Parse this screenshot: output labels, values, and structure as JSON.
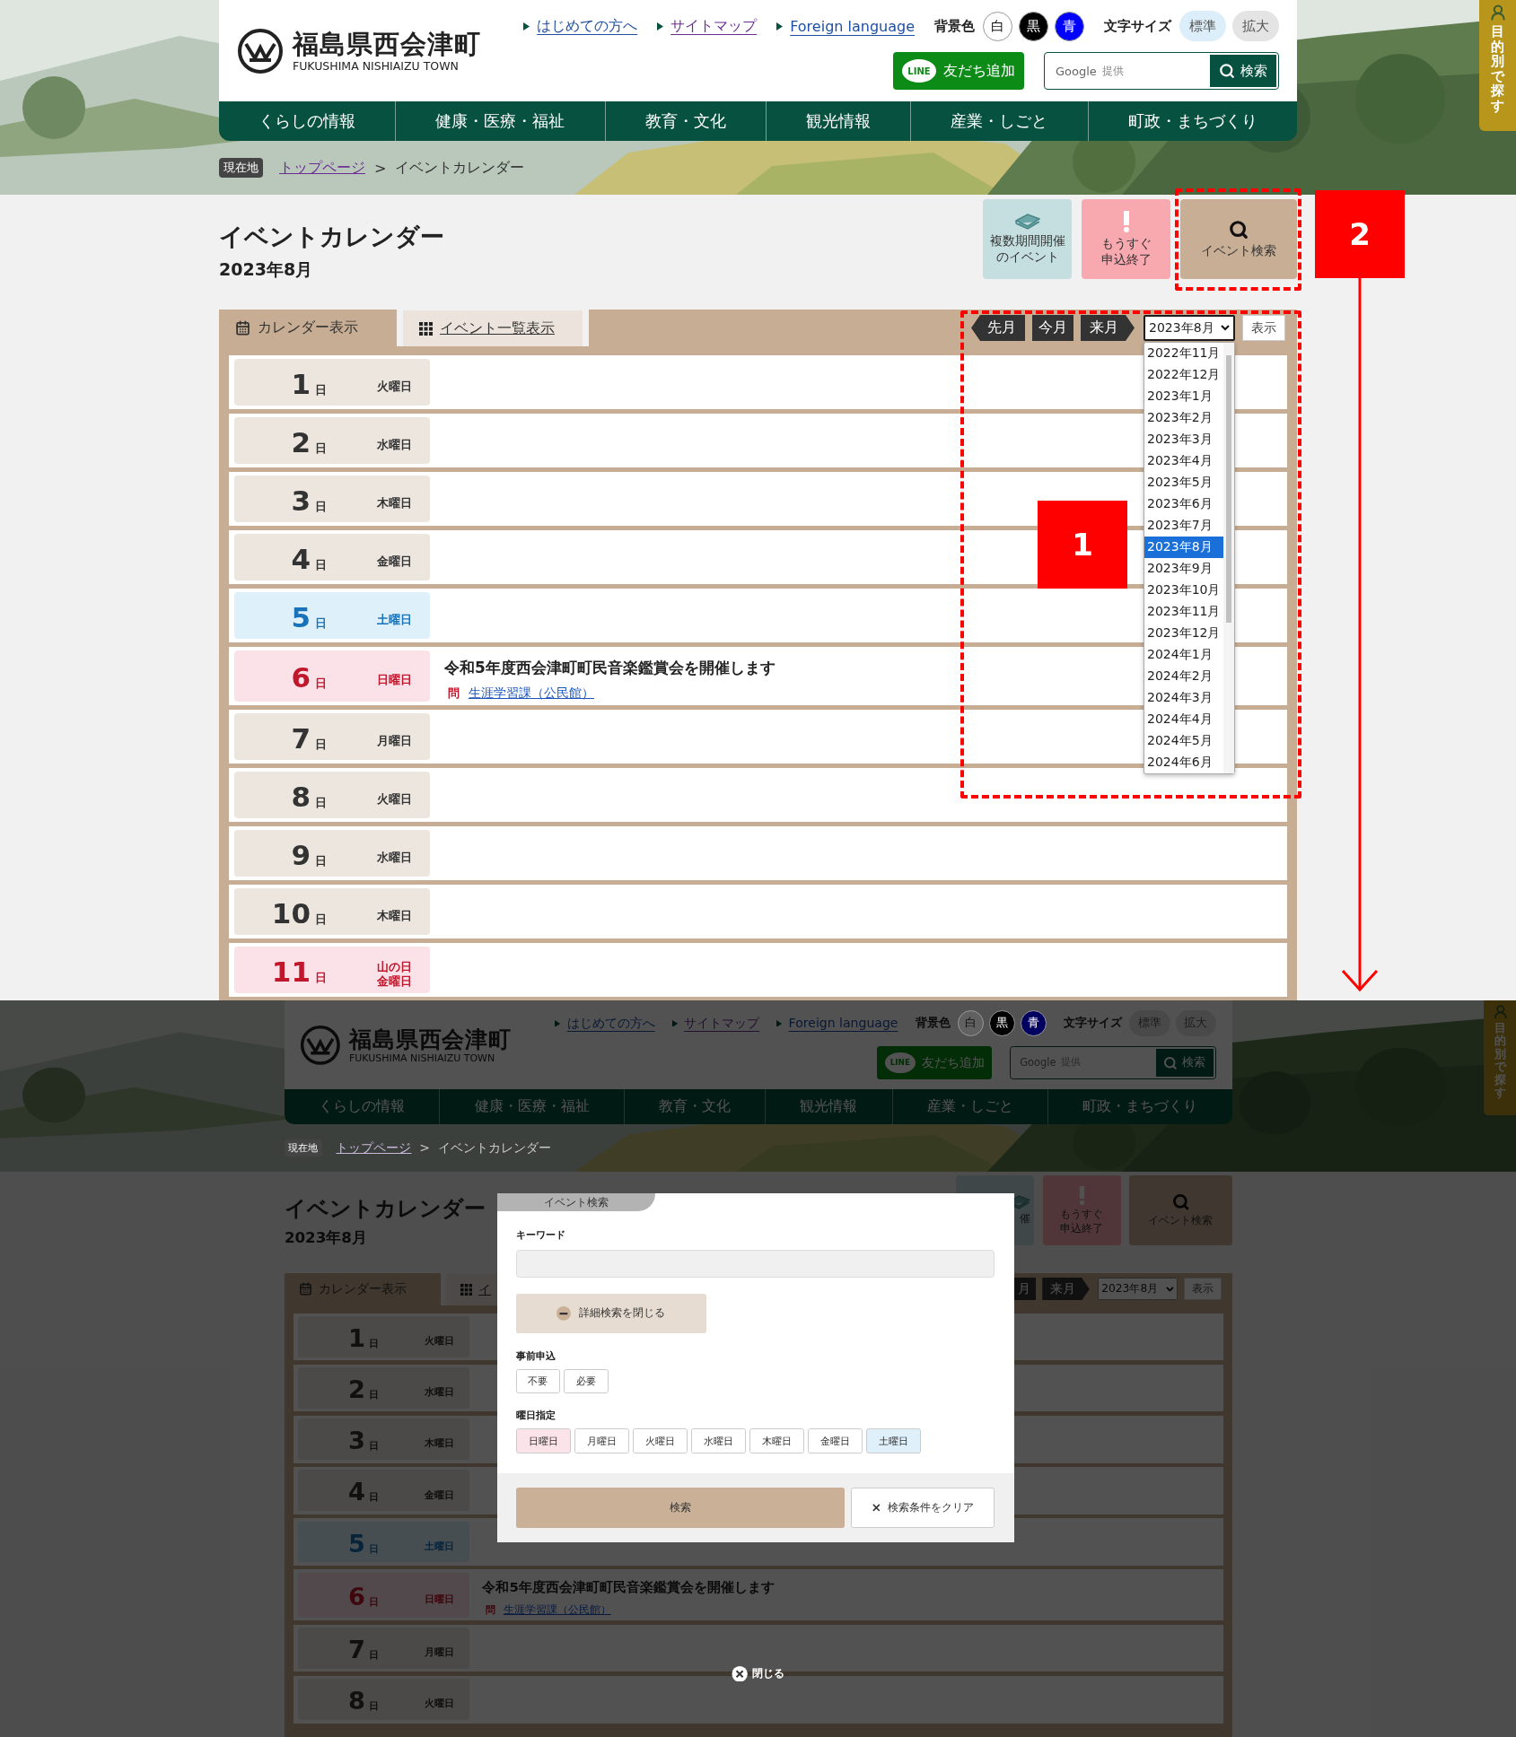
{
  "screens": [
    {
      "header": {
        "logo_title": "福島県西会津町",
        "logo_subtitle": "FUKUSHIMA NISHIAIZU TOWN",
        "links": [
          {
            "label": "はじめての方へ",
            "visited": false
          },
          {
            "label": "サイトマップ",
            "visited": true
          },
          {
            "label": "Foreign language",
            "visited": false
          }
        ],
        "bg_color_label": "背景色",
        "bg_colors": [
          {
            "label": "白",
            "color": "#ffffff"
          },
          {
            "label": "黒",
            "color": "#000000"
          },
          {
            "label": "青",
            "color": "#0000ff"
          }
        ],
        "font_size_label": "文字サイズ",
        "font_sizes": [
          {
            "label": "標準",
            "selected": true
          },
          {
            "label": "拡大",
            "selected": false
          }
        ],
        "line_button": {
          "badge": "LINE",
          "label": "友だち追加"
        },
        "search": {
          "brand": "Google",
          "brand_note": "提供",
          "button": "検索"
        }
      },
      "nav": [
        "くらしの情報",
        "健康・医療・福祉",
        "教育・文化",
        "観光情報",
        "産業・しごと",
        "町政・まちづくり"
      ],
      "side_tab": "目的別で探す",
      "breadcrumb": {
        "badge": "現在地",
        "link": "トップページ",
        "separator": ">",
        "current": "イベントカレンダー"
      },
      "page_title": "イベントカレンダー",
      "page_subtitle": "2023年8月",
      "feature_buttons": [
        {
          "kind": "multi",
          "lines": [
            "複数期間開催",
            "のイベント"
          ],
          "cut": false
        },
        {
          "kind": "deadline",
          "lines": [
            "もうすぐ",
            "申込終了"
          ],
          "cut": false
        },
        {
          "kind": "search",
          "lines": [
            "イベント検索"
          ],
          "cut": false
        }
      ],
      "tabs": [
        {
          "label": "カレンダー表示",
          "selected": true
        },
        {
          "label": "イベント一覧表示",
          "selected": false
        }
      ],
      "month_nav": [
        {
          "label": "先月",
          "kind": "prev"
        },
        {
          "label": "今月",
          "kind": "plain"
        },
        {
          "label": "来月",
          "kind": "next"
        }
      ],
      "month_select": {
        "value": "2023年8月",
        "expanded": true,
        "options": [
          {
            "label": "2022年11月",
            "selected": false
          },
          {
            "label": "2022年12月",
            "selected": false
          },
          {
            "label": "2023年1月",
            "selected": false
          },
          {
            "label": "2023年2月",
            "selected": false
          },
          {
            "label": "2023年3月",
            "selected": false
          },
          {
            "label": "2023年4月",
            "selected": false
          },
          {
            "label": "2023年5月",
            "selected": false
          },
          {
            "label": "2023年6月",
            "selected": false
          },
          {
            "label": "2023年7月",
            "selected": false
          },
          {
            "label": "2023年8月",
            "selected": true
          },
          {
            "label": "2023年9月",
            "selected": false
          },
          {
            "label": "2023年10月",
            "selected": false
          },
          {
            "label": "2023年11月",
            "selected": false
          },
          {
            "label": "2023年12月",
            "selected": false
          },
          {
            "label": "2024年1月",
            "selected": false
          },
          {
            "label": "2024年2月",
            "selected": false
          },
          {
            "label": "2024年3月",
            "selected": false
          },
          {
            "label": "2024年4月",
            "selected": false
          },
          {
            "label": "2024年5月",
            "selected": false
          },
          {
            "label": "2024年6月",
            "selected": false
          }
        ]
      },
      "show_button": "表示",
      "days": [
        {
          "day": "1",
          "unit": "日",
          "weekday": "火曜日",
          "kind": "weekday"
        },
        {
          "day": "2",
          "unit": "日",
          "weekday": "水曜日",
          "kind": "weekday"
        },
        {
          "day": "3",
          "unit": "日",
          "weekday": "木曜日",
          "kind": "weekday"
        },
        {
          "day": "4",
          "unit": "日",
          "weekday": "金曜日",
          "kind": "weekday"
        },
        {
          "day": "5",
          "unit": "日",
          "weekday": "土曜日",
          "kind": "saturday"
        },
        {
          "day": "6",
          "unit": "日",
          "weekday": "日曜日",
          "kind": "holiday",
          "events": [
            {
              "title": "令和5年度西会津町町民音楽鑑賞会を開催します",
              "contact_mark": "問",
              "contact": "生涯学習課（公民館）"
            }
          ]
        },
        {
          "day": "7",
          "unit": "日",
          "weekday": "月曜日",
          "kind": "weekday"
        },
        {
          "day": "8",
          "unit": "日",
          "weekday": "火曜日",
          "kind": "weekday"
        },
        {
          "day": "9",
          "unit": "日",
          "weekday": "水曜日",
          "kind": "weekday"
        },
        {
          "day": "10",
          "unit": "日",
          "weekday": "木曜日",
          "kind": "weekday"
        },
        {
          "day": "11",
          "unit": "日",
          "holiday_name": "山の日",
          "weekday": "金曜日",
          "kind": "holiday"
        }
      ],
      "annotations": [
        {
          "label": "1"
        },
        {
          "label": "2"
        }
      ]
    },
    {
      "header": {
        "logo_title": "福島県西会津町",
        "logo_subtitle": "FUKUSHIMA NISHIAIZU TOWN",
        "links": [
          {
            "label": "はじめての方へ",
            "visited": false
          },
          {
            "label": "サイトマップ",
            "visited": true
          },
          {
            "label": "Foreign language",
            "visited": false
          }
        ],
        "bg_color_label": "背景色",
        "bg_colors": [
          {
            "label": "白",
            "color": "#616161"
          },
          {
            "label": "黒",
            "color": "#000000"
          },
          {
            "label": "青",
            "color": "#000061"
          }
        ],
        "font_size_label": "文字サイズ",
        "font_sizes": [
          {
            "label": "標準"
          },
          {
            "label": "拡大"
          }
        ],
        "line_button": {
          "badge": "LINE",
          "label": "友だち追加"
        },
        "search": {
          "brand": "Google",
          "brand_note": "提供",
          "button": "検索"
        }
      },
      "nav": [
        "くらしの情報",
        "健康・医療・福祉",
        "教育・文化",
        "観光情報",
        "産業・しごと",
        "町政・まちづくり"
      ],
      "side_tab": "目的別で探す",
      "breadcrumb": {
        "badge": "現在地",
        "link": "トップページ",
        "separator": ">",
        "current": "イベントカレンダー"
      },
      "page_title": "イベントカレンダー",
      "page_subtitle": "2023年8月",
      "feature_buttons": [
        {
          "kind": "multi",
          "lines": [
            "催"
          ],
          "cut": true
        },
        {
          "kind": "deadline",
          "lines": [
            "もうすぐ",
            "申込終了"
          ],
          "cut": false
        },
        {
          "kind": "search",
          "lines": [
            "イベント検索"
          ],
          "cut": false
        }
      ],
      "tabs": [
        {
          "label": "カレンダー表示",
          "selected": true
        },
        {
          "label": "イ",
          "selected": false
        }
      ],
      "month_nav": [
        {
          "label": "月",
          "kind": "plain"
        },
        {
          "label": "来月",
          "kind": "next"
        }
      ],
      "month_select": {
        "value": "2023年8月"
      },
      "show_button": "表示",
      "days": [
        {
          "day": "1",
          "unit": "日",
          "weekday": "火曜日",
          "kind": "weekday"
        },
        {
          "day": "2",
          "unit": "日",
          "weekday": "水曜日",
          "kind": "weekday"
        },
        {
          "day": "3",
          "unit": "日",
          "weekday": "木曜日",
          "kind": "weekday"
        },
        {
          "day": "4",
          "unit": "日",
          "weekday": "金曜日",
          "kind": "weekday"
        },
        {
          "day": "5",
          "unit": "日",
          "weekday": "土曜日",
          "kind": "saturday"
        },
        {
          "day": "6",
          "unit": "日",
          "weekday": "日曜日",
          "kind": "holiday",
          "events": [
            {
              "title": "令和5年度西会津町町民音楽鑑賞会を開催します",
              "contact_mark": "問",
              "contact": "生涯学習課（公民館）"
            }
          ]
        },
        {
          "day": "7",
          "unit": "日",
          "weekday": "月曜日",
          "kind": "weekday"
        },
        {
          "day": "8",
          "unit": "日",
          "weekday": "火曜日",
          "kind": "weekday"
        }
      ],
      "modal": {
        "title": "イベント検索",
        "keyword_label": "キーワード",
        "toggle": "詳細検索を閉じる",
        "registration": {
          "label": "事前申込",
          "options": [
            {
              "label": "不要",
              "selected": false
            },
            {
              "label": "必要",
              "selected": false
            }
          ]
        },
        "weekdays": {
          "label": "曜日指定",
          "options": [
            {
              "label": "日曜日",
              "kind": "sunday",
              "selected": false
            },
            {
              "label": "月曜日",
              "kind": "weekday",
              "selected": false
            },
            {
              "label": "火曜日",
              "kind": "weekday",
              "selected": false
            },
            {
              "label": "水曜日",
              "kind": "weekday",
              "selected": false
            },
            {
              "label": "木曜日",
              "kind": "weekday",
              "selected": false
            },
            {
              "label": "金曜日",
              "kind": "weekday",
              "selected": false
            },
            {
              "label": "土曜日",
              "kind": "saturday",
              "selected": false
            }
          ]
        },
        "search_button": "検索",
        "clear_button": "検索条件をクリア"
      },
      "close_label": "閉じる"
    }
  ]
}
